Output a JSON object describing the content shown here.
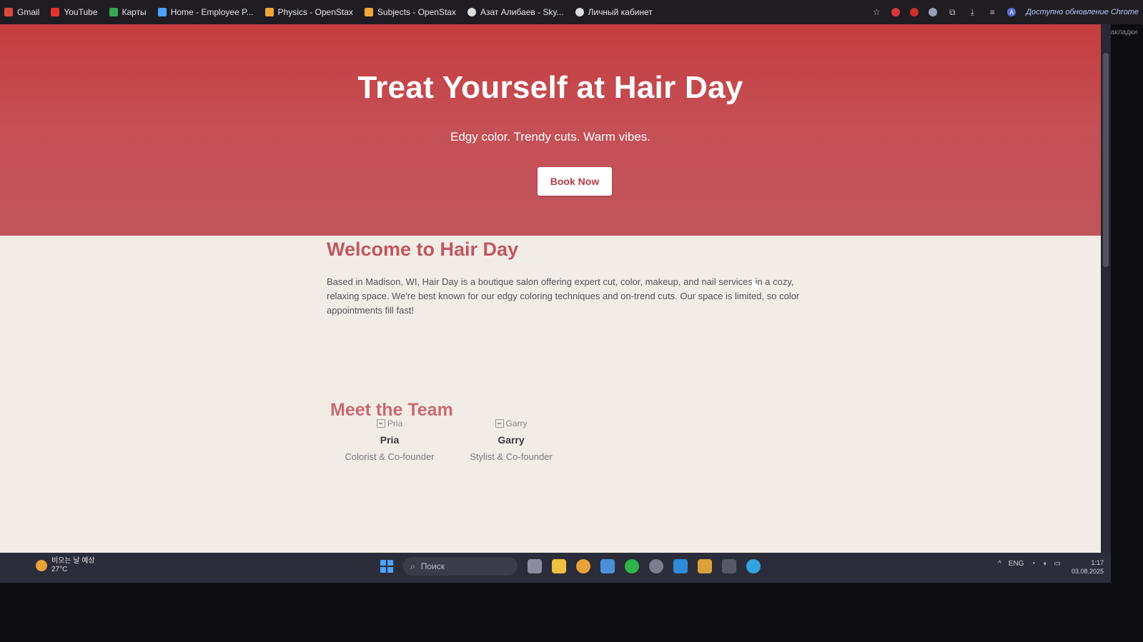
{
  "browser": {
    "bookmarks": [
      {
        "label": "Gmail",
        "icon": "gmail-icon",
        "color": "#d94c3d"
      },
      {
        "label": "YouTube",
        "icon": "youtube-icon",
        "color": "#e3342f"
      },
      {
        "label": "Карты",
        "icon": "maps-icon",
        "color": "#34a853"
      },
      {
        "label": "Home - Employee P...",
        "icon": "microsoft-icon",
        "color": "#4ba3ff"
      },
      {
        "label": "Physics - OpenStax",
        "icon": "openstax-icon",
        "color": "#f2a73b"
      },
      {
        "label": "Subjects - OpenStax",
        "icon": "openstax-icon",
        "color": "#f2a73b"
      },
      {
        "label": "Азат Алибаев - Sky...",
        "icon": "globe-icon",
        "color": "#dcdcdc"
      },
      {
        "label": "Личный кабинет",
        "icon": "globe-icon",
        "color": "#dcdcdc"
      }
    ],
    "update_text": "Доступно обновление Chrome",
    "all_bookmarks": "Все закладки",
    "avatar_letter": "A"
  },
  "hero": {
    "title": "Treat Yourself at Hair Day",
    "subtitle": "Edgy color. Trendy cuts. Warm vibes.",
    "button_label": "Book Now"
  },
  "welcome": {
    "title": "Welcome to Hair Day",
    "body": "Based in Madison, WI, Hair Day is a boutique salon offering expert cut, color, makeup, and nail services in a cozy, relaxing space. We're best known for our edgy coloring techniques and on-trend cuts. Our space is limited, so color appointments fill fast!"
  },
  "team": {
    "title": "Meet the Team",
    "members": [
      {
        "img_alt": "Pria",
        "name": "Pria",
        "role": "Colorist & Co-founder"
      },
      {
        "img_alt": "Garry",
        "name": "Garry",
        "role": "Stylist & Co-founder"
      }
    ]
  },
  "taskbar": {
    "weather_line1": "비오는 날 예상",
    "weather_line2": "27°C",
    "search_placeholder": "Поиск",
    "lang": "ENG",
    "time": "1:17",
    "date": "03.08.2025"
  },
  "colors": {
    "hero_red": "#c43d3f",
    "accent_pink": "#c0575f",
    "button_text": "#b43d43"
  }
}
